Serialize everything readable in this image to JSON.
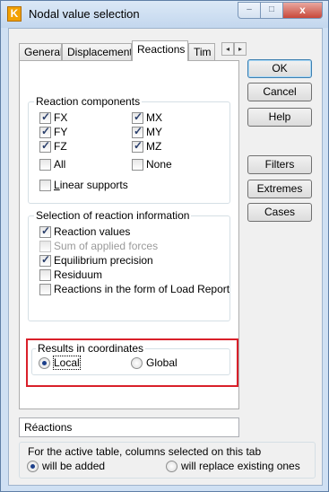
{
  "window": {
    "title": "Nodal value selection",
    "icon_letter": "K",
    "caption_buttons": {
      "minimize": "–",
      "maximize": "□",
      "close": "x"
    }
  },
  "tabs": [
    {
      "label": "General",
      "active": false
    },
    {
      "label": "Displacements",
      "active": false
    },
    {
      "label": "Reactions",
      "active": true
    },
    {
      "label": "Tim",
      "active": false
    }
  ],
  "tab_arrows": {
    "left": "◂",
    "right": "▸"
  },
  "reaction_components": {
    "title": "Reaction components",
    "items": [
      {
        "label": "FX",
        "checked": true
      },
      {
        "label": "MX",
        "checked": true
      },
      {
        "label": "FY",
        "checked": true
      },
      {
        "label": "MY",
        "checked": true
      },
      {
        "label": "FZ",
        "checked": true
      },
      {
        "label": "MZ",
        "checked": true
      },
      {
        "label": "All",
        "checked": false
      },
      {
        "label": "None",
        "checked": false
      }
    ],
    "linear_supports": {
      "label_mnemonic": "L",
      "label_rest": "inear supports",
      "checked": false
    }
  },
  "selection_info": {
    "title": "Selection of reaction information",
    "items": [
      {
        "label": "Reaction values",
        "checked": true,
        "enabled": true
      },
      {
        "label": "Sum of applied forces",
        "checked": false,
        "enabled": false
      },
      {
        "label": "Equilibrium precision",
        "checked": true,
        "enabled": true
      },
      {
        "label": "Residuum",
        "checked": false,
        "enabled": true
      },
      {
        "label": "Reactions in the form of Load Report",
        "checked": false,
        "enabled": true
      }
    ]
  },
  "results_coordinates": {
    "title": "Results in coordinates",
    "options": [
      {
        "label": "Local",
        "selected": true
      },
      {
        "label": "Global",
        "selected": false
      }
    ]
  },
  "buttons": {
    "ok": "OK",
    "cancel": "Cancel",
    "help": "Help",
    "filters": "Filters",
    "extremes": "Extremes",
    "cases": "Cases"
  },
  "name_field": {
    "value": "Réactions"
  },
  "active_table": {
    "title": "For the active table, columns selected on this tab",
    "options": [
      {
        "label": "will be added",
        "selected": true
      },
      {
        "label": "will replace existing ones",
        "selected": false
      }
    ]
  },
  "colors": {
    "highlight": "#d9202a",
    "accent": "#3c7fb1"
  }
}
